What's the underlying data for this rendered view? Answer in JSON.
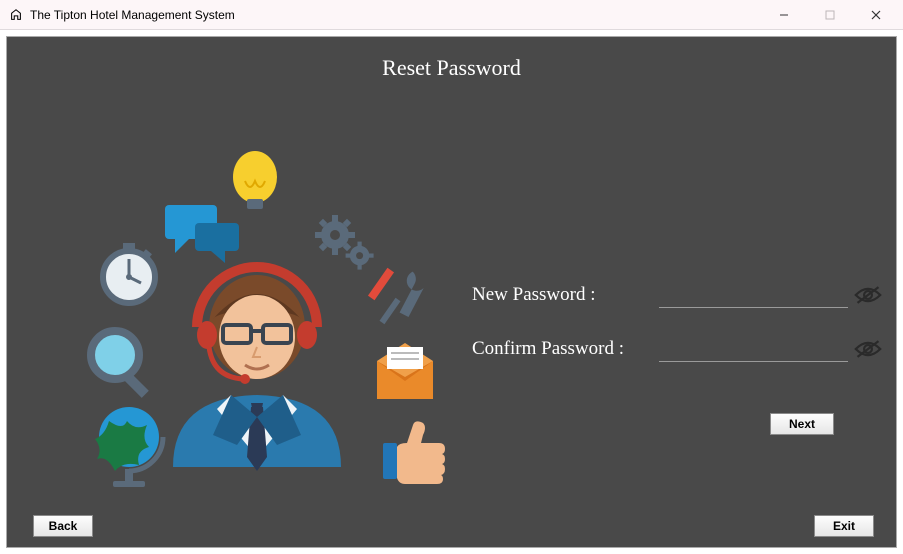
{
  "window": {
    "title": "The Tipton Hotel Management System"
  },
  "page": {
    "title": "Reset Password"
  },
  "form": {
    "new_password": {
      "label": "New Password :",
      "value": ""
    },
    "confirm_password": {
      "label": "Confirm Password :",
      "value": ""
    }
  },
  "buttons": {
    "next": "Next",
    "back": "Back",
    "exit": "Exit"
  },
  "icons": {
    "app": "hotel-icon",
    "minimize": "minimize-icon",
    "maximize": "maximize-icon",
    "close": "close-icon",
    "eye": "eye-hidden-icon"
  }
}
